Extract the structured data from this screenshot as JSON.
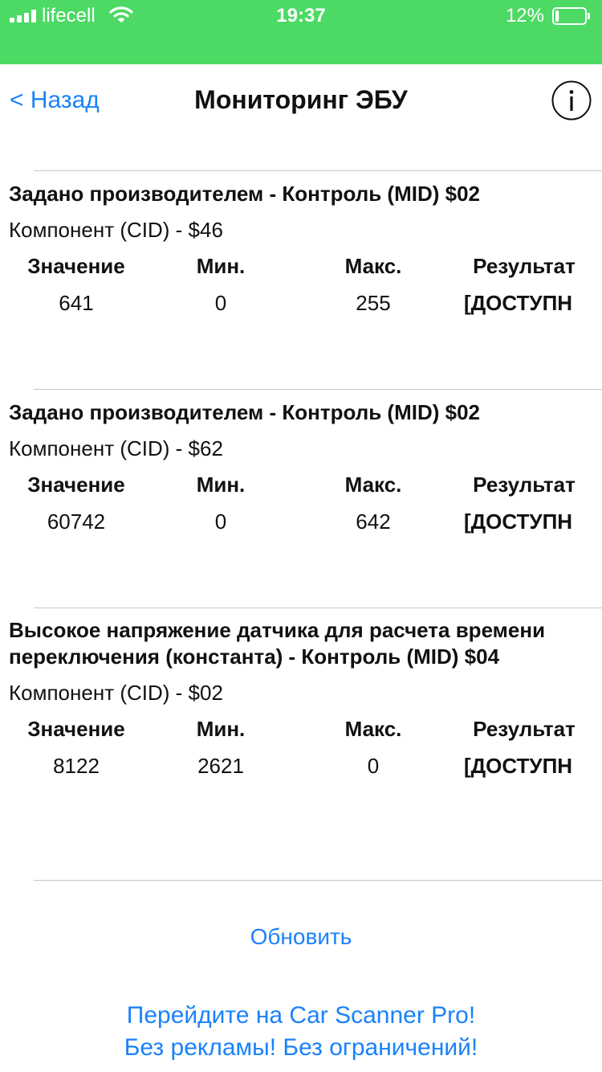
{
  "status_bar": {
    "carrier": "lifecell",
    "time": "19:37",
    "battery_percent": "12%",
    "battery_level": 0.12,
    "signal_bars": 4,
    "wifi": true,
    "background_color": "#4cd964"
  },
  "nav": {
    "back_label": "< Назад",
    "title": "Мониторинг ЭБУ",
    "info_icon": "info-icon"
  },
  "columns": {
    "value": "Значение",
    "min": "Мин.",
    "max": "Макс.",
    "result": "Результат"
  },
  "tests": [
    {
      "title": "Задано производителем - Контроль (MID) $02",
      "component": "Компонент (CID) - $46",
      "value": "641",
      "min": "0",
      "max": "255",
      "result": "[ДОСТУПН"
    },
    {
      "title": "Задано производителем - Контроль (MID) $02",
      "component": "Компонент (CID) - $62",
      "value": "60742",
      "min": "0",
      "max": "642",
      "result": "[ДОСТУПН"
    },
    {
      "title": "Высокое напряжение датчика для расчета времени переключения (константа) - Контроль (MID) $04",
      "component": "Компонент (CID) - $02",
      "value": "8122",
      "min": "2621",
      "max": "0",
      "result": "[ДОСТУПН"
    }
  ],
  "refresh_label": "Обновить",
  "promo": {
    "line1": "Перейдите на Car Scanner Pro!",
    "line2": "Без рекламы! Без ограничений!"
  },
  "colors": {
    "accent": "#1a82fb",
    "divider": "#c8c7cc"
  }
}
